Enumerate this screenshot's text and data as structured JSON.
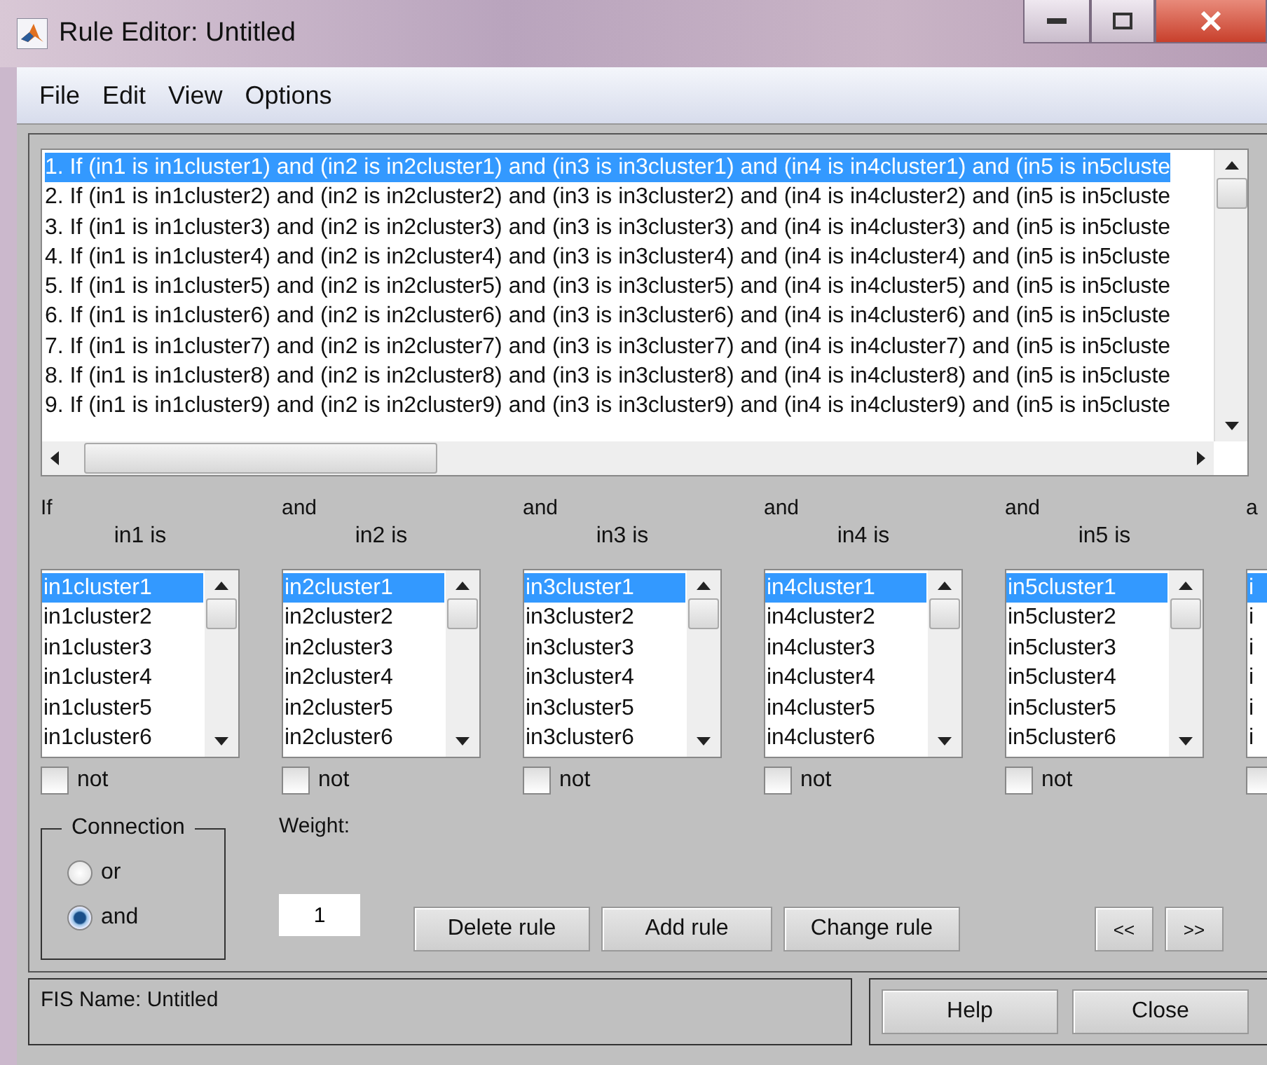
{
  "window": {
    "title": "Rule Editor: Untitled"
  },
  "menu": [
    "File",
    "Edit",
    "View",
    "Options"
  ],
  "rules": [
    {
      "text": "1. If (in1 is in1cluster1) and (in2 is in2cluster1) and (in3 is in3cluster1) and (in4 is in4cluster1) and (in5 is in5cluste",
      "selected": true
    },
    {
      "text": "2. If (in1 is in1cluster2) and (in2 is in2cluster2) and (in3 is in3cluster2) and (in4 is in4cluster2) and (in5 is in5cluste",
      "selected": false
    },
    {
      "text": "3. If (in1 is in1cluster3) and (in2 is in2cluster3) and (in3 is in3cluster3) and (in4 is in4cluster3) and (in5 is in5cluste",
      "selected": false
    },
    {
      "text": "4. If (in1 is in1cluster4) and (in2 is in2cluster4) and (in3 is in3cluster4) and (in4 is in4cluster4) and (in5 is in5cluste",
      "selected": false
    },
    {
      "text": "5. If (in1 is in1cluster5) and (in2 is in2cluster5) and (in3 is in3cluster5) and (in4 is in4cluster5) and (in5 is in5cluste",
      "selected": false
    },
    {
      "text": "6. If (in1 is in1cluster6) and (in2 is in2cluster6) and (in3 is in3cluster6) and (in4 is in4cluster6) and (in5 is in5cluste",
      "selected": false
    },
    {
      "text": "7. If (in1 is in1cluster7) and (in2 is in2cluster7) and (in3 is in3cluster7) and (in4 is in4cluster7) and (in5 is in5cluste",
      "selected": false
    },
    {
      "text": "8. If (in1 is in1cluster8) and (in2 is in2cluster8) and (in3 is in3cluster8) and (in4 is in4cluster8) and (in5 is in5cluste",
      "selected": false
    },
    {
      "text": "9. If (in1 is in1cluster9) and (in2 is in2cluster9) and (in3 is in3cluster9) and (in4 is in4cluster9) and (in5 is in5cluste",
      "selected": false
    }
  ],
  "antecedents": [
    {
      "connector": "If",
      "heading": "in1 is",
      "items": [
        {
          "label": "in1cluster1",
          "selected": true
        },
        {
          "label": "in1cluster2",
          "selected": false
        },
        {
          "label": "in1cluster3",
          "selected": false
        },
        {
          "label": "in1cluster4",
          "selected": false
        },
        {
          "label": "in1cluster5",
          "selected": false
        },
        {
          "label": "in1cluster6",
          "selected": false
        }
      ],
      "not": {
        "label": "not",
        "checked": false
      }
    },
    {
      "connector": "and",
      "heading": "in2 is",
      "items": [
        {
          "label": "in2cluster1",
          "selected": true
        },
        {
          "label": "in2cluster2",
          "selected": false
        },
        {
          "label": "in2cluster3",
          "selected": false
        },
        {
          "label": "in2cluster4",
          "selected": false
        },
        {
          "label": "in2cluster5",
          "selected": false
        },
        {
          "label": "in2cluster6",
          "selected": false
        }
      ],
      "not": {
        "label": "not",
        "checked": false
      }
    },
    {
      "connector": "and",
      "heading": "in3 is",
      "items": [
        {
          "label": "in3cluster1",
          "selected": true
        },
        {
          "label": "in3cluster2",
          "selected": false
        },
        {
          "label": "in3cluster3",
          "selected": false
        },
        {
          "label": "in3cluster4",
          "selected": false
        },
        {
          "label": "in3cluster5",
          "selected": false
        },
        {
          "label": "in3cluster6",
          "selected": false
        }
      ],
      "not": {
        "label": "not",
        "checked": false
      }
    },
    {
      "connector": "and",
      "heading": "in4 is",
      "items": [
        {
          "label": "in4cluster1",
          "selected": true
        },
        {
          "label": "in4cluster2",
          "selected": false
        },
        {
          "label": "in4cluster3",
          "selected": false
        },
        {
          "label": "in4cluster4",
          "selected": false
        },
        {
          "label": "in4cluster5",
          "selected": false
        },
        {
          "label": "in4cluster6",
          "selected": false
        }
      ],
      "not": {
        "label": "not",
        "checked": false
      }
    },
    {
      "connector": "and",
      "heading": "in5 is",
      "items": [
        {
          "label": "in5cluster1",
          "selected": true
        },
        {
          "label": "in5cluster2",
          "selected": false
        },
        {
          "label": "in5cluster3",
          "selected": false
        },
        {
          "label": "in5cluster4",
          "selected": false
        },
        {
          "label": "in5cluster5",
          "selected": false
        },
        {
          "label": "in5cluster6",
          "selected": false
        }
      ],
      "not": {
        "label": "not",
        "checked": false
      }
    },
    {
      "connector": "a",
      "items": [
        {
          "label": "i",
          "selected": true
        },
        {
          "label": "i",
          "selected": false
        },
        {
          "label": "i",
          "selected": false
        },
        {
          "label": "i",
          "selected": false
        },
        {
          "label": "i",
          "selected": false
        },
        {
          "label": "i",
          "selected": false
        }
      ],
      "not": {
        "checked": false
      }
    }
  ],
  "connection": {
    "title": "Connection",
    "options": [
      {
        "label": "or",
        "selected": false
      },
      {
        "label": "and",
        "selected": true
      }
    ]
  },
  "weight": {
    "label": "Weight:",
    "value": "1"
  },
  "buttons": [
    "Delete rule",
    "Add rule",
    "Change rule"
  ],
  "nav": [
    "<<",
    ">>"
  ],
  "status": "FIS Name: Untitled",
  "footer_buttons": [
    "Help",
    "Close"
  ]
}
